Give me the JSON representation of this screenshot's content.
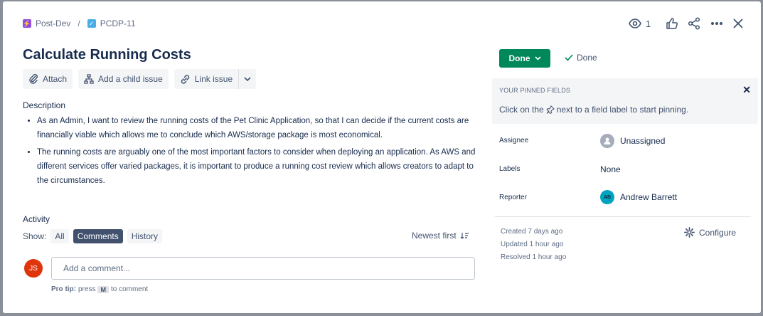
{
  "breadcrumb": {
    "project": "Post-Dev",
    "separator": "/",
    "issue_key": "PCDP-11"
  },
  "header": {
    "watch_count": "1"
  },
  "issue": {
    "title": "Calculate Running Costs",
    "actions": {
      "attach": "Attach",
      "add_child": "Add a child issue",
      "link_issue": "Link issue"
    },
    "description_label": "Description",
    "description_items": [
      "As an Admin, I want to review the running costs of the Pet Clinic Application, so that I can decide if the current costs are financially viable which allows me to conclude which AWS/storage package is most economical.",
      "The running costs are arguably one of the most important factors to consider when deploying an application. As AWS and different services offer varied packages, it is important to produce a running cost review which allows creators to adapt to the circumstances."
    ]
  },
  "activity": {
    "label": "Activity",
    "show_label": "Show:",
    "filters": [
      "All",
      "Comments",
      "History"
    ],
    "active_filter": "Comments",
    "sort_label": "Newest first",
    "user_initials": "JS",
    "comment_placeholder": "Add a comment...",
    "protip_bold": "Pro tip:",
    "protip_press": "press",
    "protip_key": "M",
    "protip_rest": "to comment"
  },
  "status": {
    "button_label": "Done",
    "resolution": "Done"
  },
  "pinned": {
    "title": "YOUR PINNED FIELDS",
    "text_before": "Click on the",
    "text_after": "next to a field label to start pinning."
  },
  "fields": {
    "assignee_label": "Assignee",
    "assignee_value": "Unassigned",
    "labels_label": "Labels",
    "labels_value": "None",
    "reporter_label": "Reporter",
    "reporter_value": "Andrew Barrett",
    "reporter_initials": "AB"
  },
  "meta": {
    "created": "Created 7 days ago",
    "updated": "Updated 1 hour ago",
    "resolved": "Resolved 1 hour ago",
    "configure": "Configure"
  },
  "colors": {
    "done_green": "#00875a",
    "epic_purple": "#904ee2",
    "task_blue": "#4bade8",
    "avatar_js": "#de350b",
    "avatar_ab": "#00a3bf"
  },
  "icons": [
    "epic-icon",
    "task-icon",
    "eye-icon",
    "thumbs-up-icon",
    "share-icon",
    "more-icon",
    "close-icon",
    "paperclip-icon",
    "child-issue-icon",
    "link-icon",
    "chevron-down-icon",
    "sort-icon",
    "check-icon",
    "pin-icon",
    "user-icon",
    "gear-icon"
  ]
}
